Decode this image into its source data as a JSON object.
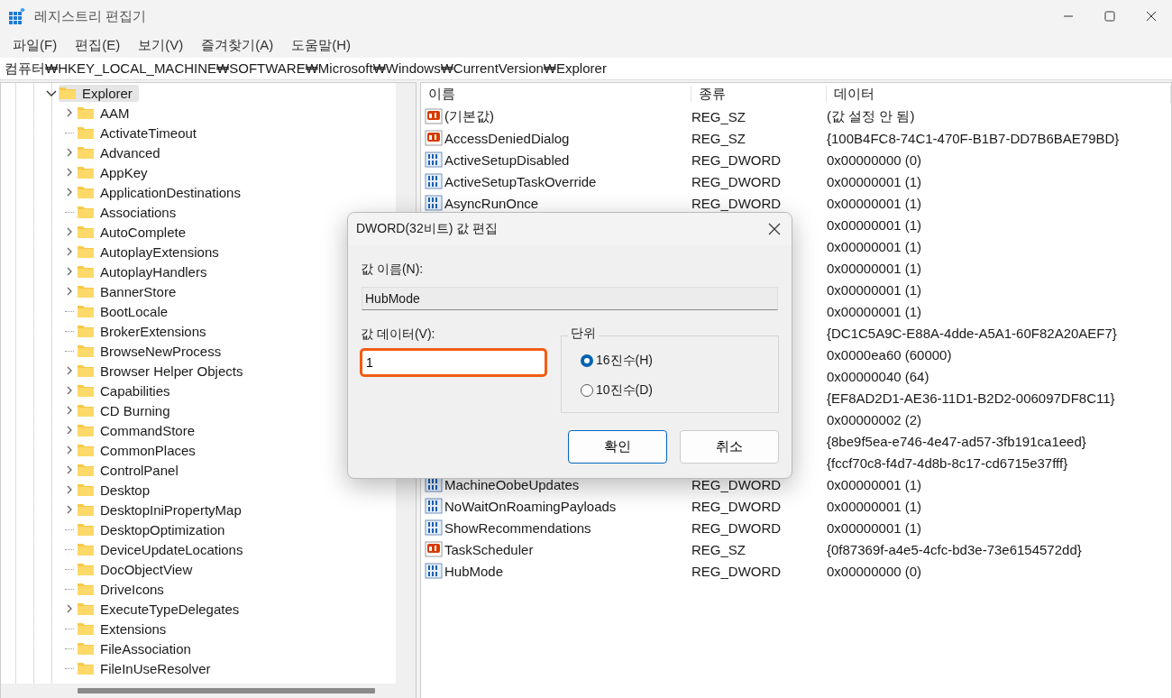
{
  "window": {
    "title": "레지스트리 편집기"
  },
  "menu": [
    "파일(F)",
    "편집(E)",
    "보기(V)",
    "즐겨찾기(A)",
    "도움말(H)"
  ],
  "address": "컴퓨터₩HKEY_LOCAL_MACHINE₩SOFTWARE₩Microsoft₩Windows₩CurrentVersion₩Explorer",
  "tree": [
    {
      "label": "Explorer",
      "expanded": true,
      "selected": true,
      "children": [
        {
          "label": "AAM",
          "expandable": true
        },
        {
          "label": "ActivateTimeout",
          "expandable": false
        },
        {
          "label": "Advanced",
          "expandable": true
        },
        {
          "label": "AppKey",
          "expandable": true
        },
        {
          "label": "ApplicationDestinations",
          "expandable": true
        },
        {
          "label": "Associations",
          "expandable": false
        },
        {
          "label": "AutoComplete",
          "expandable": true
        },
        {
          "label": "AutoplayExtensions",
          "expandable": true
        },
        {
          "label": "AutoplayHandlers",
          "expandable": true
        },
        {
          "label": "BannerStore",
          "expandable": true
        },
        {
          "label": "BootLocale",
          "expandable": false
        },
        {
          "label": "BrokerExtensions",
          "expandable": false
        },
        {
          "label": "BrowseNewProcess",
          "expandable": false
        },
        {
          "label": "Browser Helper Objects",
          "expandable": true
        },
        {
          "label": "Capabilities",
          "expandable": true
        },
        {
          "label": "CD Burning",
          "expandable": true
        },
        {
          "label": "CommandStore",
          "expandable": true
        },
        {
          "label": "CommonPlaces",
          "expandable": true
        },
        {
          "label": "ControlPanel",
          "expandable": true
        },
        {
          "label": "Desktop",
          "expandable": true
        },
        {
          "label": "DesktopIniPropertyMap",
          "expandable": true
        },
        {
          "label": "DesktopOptimization",
          "expandable": false
        },
        {
          "label": "DeviceUpdateLocations",
          "expandable": false
        },
        {
          "label": "DocObjectView",
          "expandable": false
        },
        {
          "label": "DriveIcons",
          "expandable": false
        },
        {
          "label": "ExecuteTypeDelegates",
          "expandable": true
        },
        {
          "label": "Extensions",
          "expandable": false
        },
        {
          "label": "FileAssociation",
          "expandable": false
        },
        {
          "label": "FileInUseResolver",
          "expandable": false
        }
      ]
    }
  ],
  "table": {
    "columns": [
      "이름",
      "종류",
      "데이터"
    ],
    "rows": [
      {
        "kind": "string",
        "name": "(기본값)",
        "type": "REG_SZ",
        "data": "(값 설정 안 됨)"
      },
      {
        "kind": "string",
        "name": "AccessDeniedDialog",
        "type": "REG_SZ",
        "data": "{100B4FC8-74C1-470F-B1B7-DD7B6BAE79BD}"
      },
      {
        "kind": "binary",
        "name": "ActiveSetupDisabled",
        "type": "REG_DWORD",
        "data": "0x00000000 (0)"
      },
      {
        "kind": "binary",
        "name": "ActiveSetupTaskOverride",
        "type": "REG_DWORD",
        "data": "0x00000001 (1)"
      },
      {
        "kind": "binary",
        "name": "AsyncRunOnce",
        "type": "REG_DWORD",
        "data": "0x00000001 (1)"
      },
      {
        "data": "0x00000001 (1)"
      },
      {
        "data": "0x00000001 (1)"
      },
      {
        "data": "0x00000001 (1)"
      },
      {
        "data": "0x00000001 (1)"
      },
      {
        "data": "0x00000001 (1)"
      },
      {
        "data": "{DC1C5A9C-E88A-4dde-A5A1-60F82A20AEF7}"
      },
      {
        "data": "0x0000ea60 (60000)"
      },
      {
        "data": "0x00000040 (64)"
      },
      {
        "data": "{EF8AD2D1-AE36-11D1-B2D2-006097DF8C11}"
      },
      {
        "data": "0x00000002 (2)"
      },
      {
        "data": "{8be9f5ea-e746-4e47-ad57-3fb191ca1eed}"
      },
      {
        "data": "{fccf70c8-f4d7-4d8b-8c17-cd6715e37fff}"
      },
      {
        "kind": "binary",
        "name": "MachineOobeUpdates",
        "type": "REG_DWORD",
        "data": "0x00000001 (1)"
      },
      {
        "kind": "binary",
        "name": "NoWaitOnRoamingPayloads",
        "type": "REG_DWORD",
        "data": "0x00000001 (1)"
      },
      {
        "kind": "binary",
        "name": "ShowRecommendations",
        "type": "REG_DWORD",
        "data": "0x00000001 (1)"
      },
      {
        "kind": "string",
        "name": "TaskScheduler",
        "type": "REG_SZ",
        "data": "{0f87369f-a4e5-4cfc-bd3e-73e6154572dd}"
      },
      {
        "kind": "binary",
        "name": "HubMode",
        "type": "REG_DWORD",
        "data": "0x00000000 (0)"
      }
    ]
  },
  "dialog": {
    "title": "DWORD(32비트) 값 편집",
    "name_label": "값 이름(N):",
    "name_value": "HubMode",
    "data_label": "값 데이터(V):",
    "data_value": "1",
    "base_label": "단위",
    "bases": [
      {
        "label": "16진수(H)",
        "selected": true
      },
      {
        "label": "10진수(D)",
        "selected": false
      }
    ],
    "buttons": [
      "확인",
      "취소"
    ]
  }
}
